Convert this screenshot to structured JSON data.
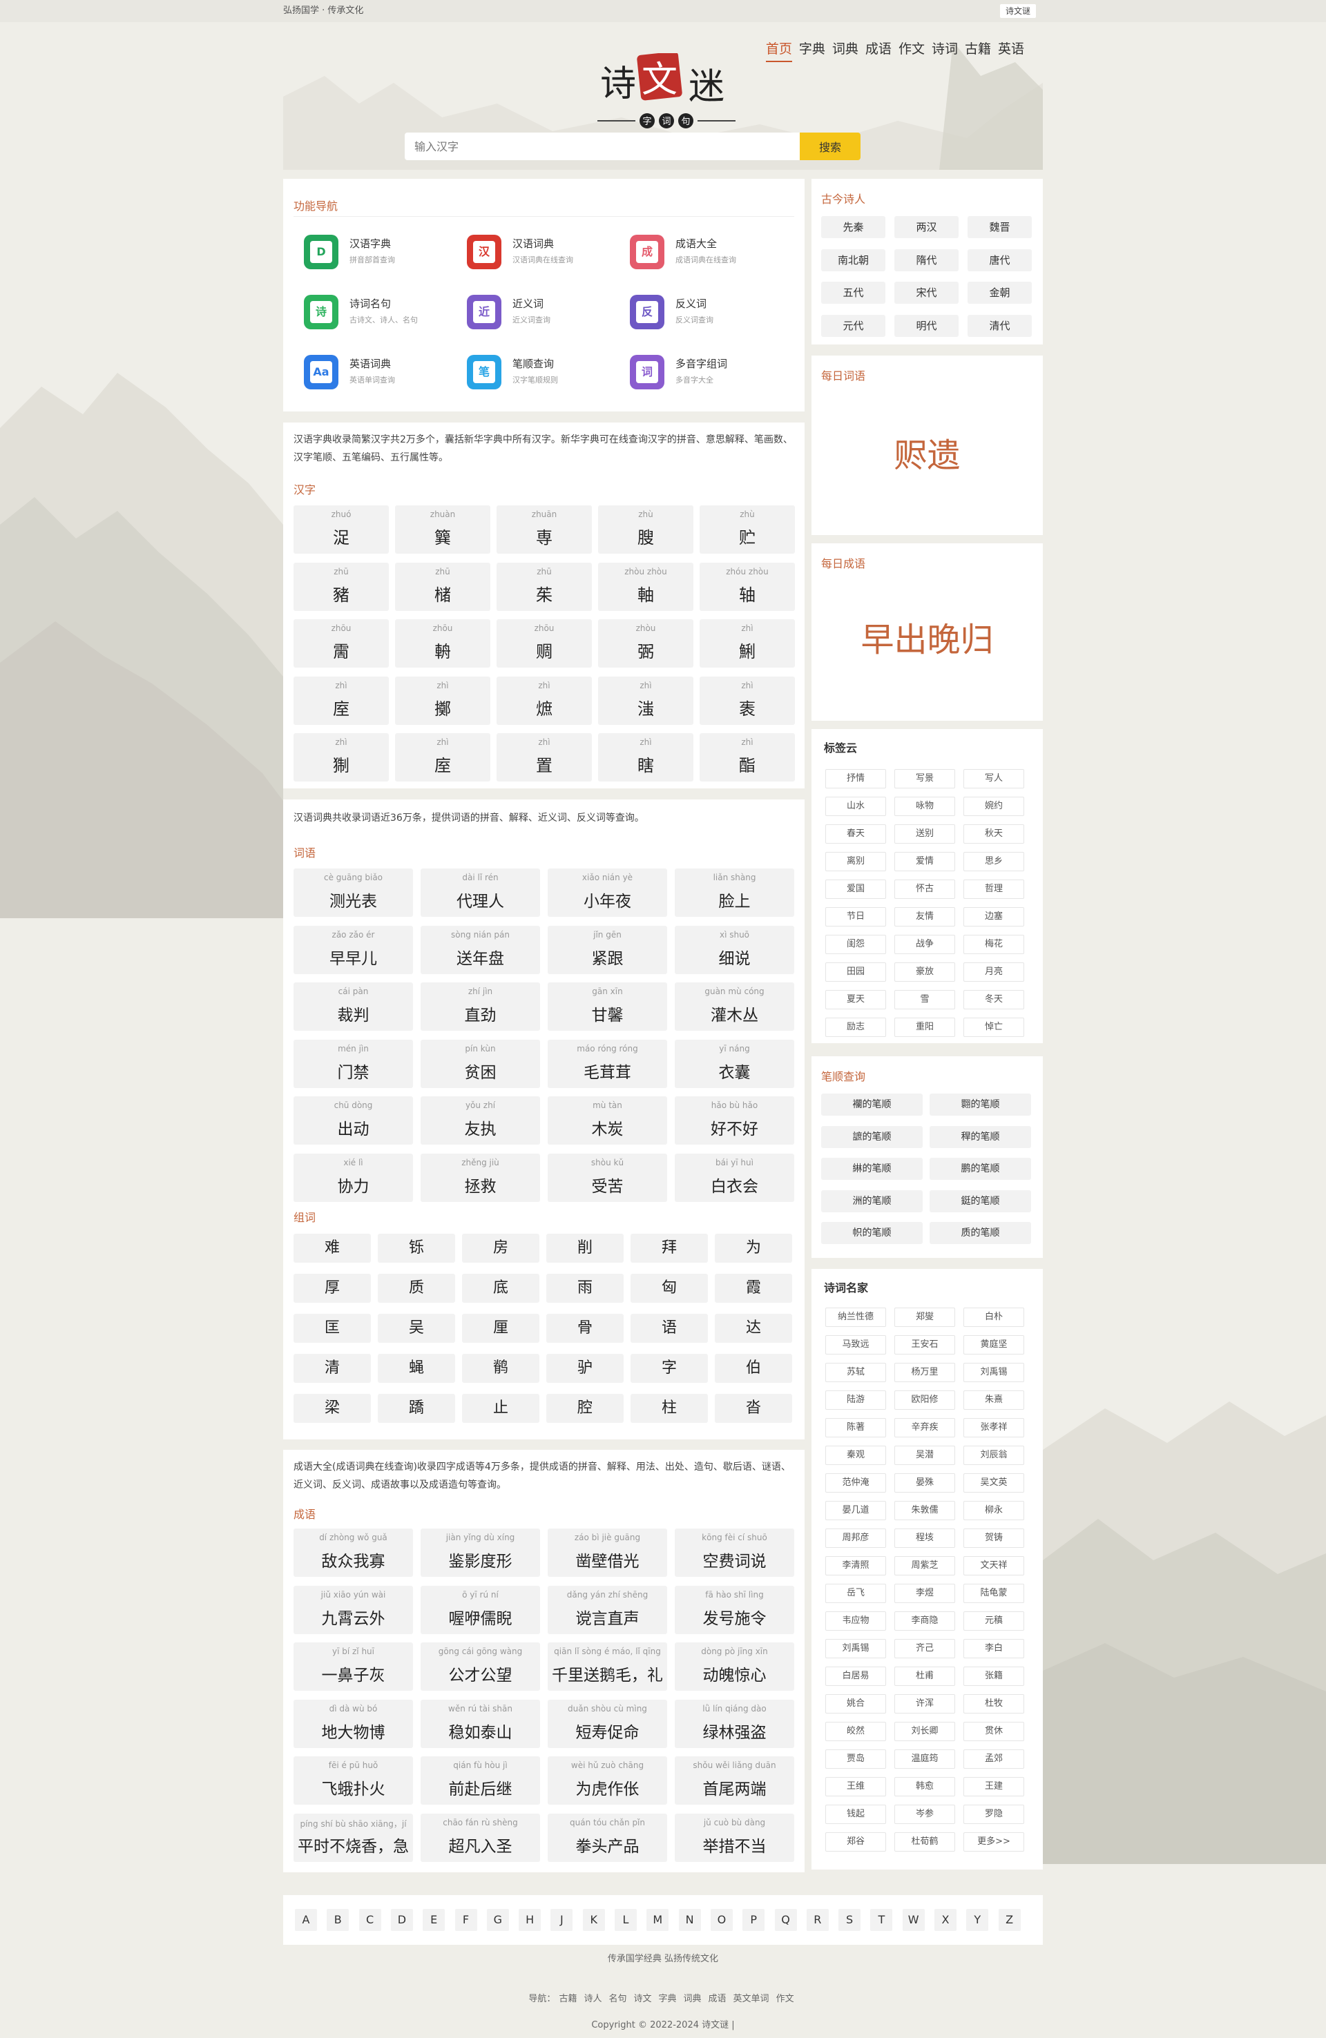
{
  "topbar": {
    "slogan": "弘扬国学 · 传承文化",
    "button": "诗文谜"
  },
  "logo": {
    "main": [
      "诗",
      "文",
      "迷"
    ],
    "sub": [
      "字",
      "词",
      "句"
    ]
  },
  "nav": [
    "首页",
    "字典",
    "词典",
    "成语",
    "作文",
    "诗词",
    "古籍",
    "英语"
  ],
  "search": {
    "placeholder": "输入汉字",
    "button": "搜索"
  },
  "features": {
    "title": "功能导航",
    "items": [
      {
        "name": "汉语字典",
        "desc": "拼音部首查询",
        "icon": "D",
        "color": "#23a55b"
      },
      {
        "name": "汉语词典",
        "desc": "汉语词典在线查询",
        "icon": "汉",
        "color": "#d9382e"
      },
      {
        "name": "成语大全",
        "desc": "成语词典在线查询",
        "icon": "成",
        "color": "#e45b6c"
      },
      {
        "name": "诗词名句",
        "desc": "古诗文、诗人、名句",
        "icon": "诗",
        "color": "#2bb25d"
      },
      {
        "name": "近义词",
        "desc": "近义词查询",
        "icon": "近",
        "color": "#7b5bc9"
      },
      {
        "name": "反义词",
        "desc": "反义词查询",
        "icon": "反",
        "color": "#6d57c4"
      },
      {
        "name": "英语词典",
        "desc": "英语单词查询",
        "icon": "Aa",
        "color": "#2d7be6"
      },
      {
        "name": "笔顺查询",
        "desc": "汉字笔顺规则",
        "icon": "笔",
        "color": "#28a4e6"
      },
      {
        "name": "多音字组词",
        "desc": "多音字大全",
        "icon": "词",
        "color": "#8a5ccf"
      }
    ]
  },
  "dict": {
    "intro": "汉语字典收录简繁汉字共2万多个，囊括新华字典中所有汉字。新华字典可在线查询汉字的拼音、意思解释、笔画数、汉字笔顺、五笔编码、五行属性等。",
    "title": "汉字",
    "cells": [
      {
        "py": "zhuó",
        "hz": "浞"
      },
      {
        "py": "zhuàn",
        "hz": "簨"
      },
      {
        "py": "zhuān",
        "hz": "専"
      },
      {
        "py": "zhù",
        "hz": "膄"
      },
      {
        "py": "zhù",
        "hz": "贮"
      },
      {
        "py": "zhū",
        "hz": "豬"
      },
      {
        "py": "zhū",
        "hz": "槠"
      },
      {
        "py": "zhū",
        "hz": "茱"
      },
      {
        "py": "zhòu zhòu",
        "hz": "軸"
      },
      {
        "py": "zhóu zhòu",
        "hz": "轴"
      },
      {
        "py": "zhōu",
        "hz": "霌"
      },
      {
        "py": "zhōu",
        "hz": "輈"
      },
      {
        "py": "zhōu",
        "hz": "赒"
      },
      {
        "py": "zhòu",
        "hz": "弻"
      },
      {
        "py": "zhì",
        "hz": "鯏"
      },
      {
        "py": "zhì",
        "hz": "庢"
      },
      {
        "py": "zhì",
        "hz": "擲"
      },
      {
        "py": "zhì",
        "hz": "熫"
      },
      {
        "py": "zhì",
        "hz": "滍"
      },
      {
        "py": "zhì",
        "hz": "袠"
      },
      {
        "py": "zhì",
        "hz": "猘"
      },
      {
        "py": "zhì",
        "hz": "庢"
      },
      {
        "py": "zhì",
        "hz": "置"
      },
      {
        "py": "zhì",
        "hz": "瞎"
      },
      {
        "py": "zhì",
        "hz": "酯"
      }
    ]
  },
  "words": {
    "intro": "汉语词典共收录词语近36万条，提供词语的拼音、解释、近义词、反义词等查询。",
    "title": "词语",
    "cells": [
      {
        "py": "cè guāng biǎo",
        "hz": "测光表"
      },
      {
        "py": "dài lǐ rén",
        "hz": "代理人"
      },
      {
        "py": "xiǎo nián yè",
        "hz": "小年夜"
      },
      {
        "py": "liǎn shàng",
        "hz": "脸上"
      },
      {
        "py": "zǎo zǎo ér",
        "hz": "早早儿"
      },
      {
        "py": "sòng nián pán",
        "hz": "送年盘"
      },
      {
        "py": "jǐn gēn",
        "hz": "紧跟"
      },
      {
        "py": "xì shuō",
        "hz": "细说"
      },
      {
        "py": "cái pàn",
        "hz": "裁判"
      },
      {
        "py": "zhí jìn",
        "hz": "直劲"
      },
      {
        "py": "gān xīn",
        "hz": "甘馨"
      },
      {
        "py": "guàn mù cóng",
        "hz": "灌木丛"
      },
      {
        "py": "mén jìn",
        "hz": "门禁"
      },
      {
        "py": "pín kùn",
        "hz": "贫困"
      },
      {
        "py": "máo róng róng",
        "hz": "毛茸茸"
      },
      {
        "py": "yī náng",
        "hz": "衣囊"
      },
      {
        "py": "chū dòng",
        "hz": "出动"
      },
      {
        "py": "yǒu zhí",
        "hz": "友执"
      },
      {
        "py": "mù tàn",
        "hz": "木炭"
      },
      {
        "py": "hǎo bù hǎo",
        "hz": "好不好"
      },
      {
        "py": "xié lì",
        "hz": "协力"
      },
      {
        "py": "zhěng jiù",
        "hz": "拯救"
      },
      {
        "py": "shòu kǔ",
        "hz": "受苦"
      },
      {
        "py": "bái yī huì",
        "hz": "白衣会"
      }
    ]
  },
  "zuci": {
    "title": "组词",
    "chars": [
      "难",
      "铄",
      "房",
      "削",
      "拜",
      "为",
      "厚",
      "质",
      "底",
      "雨",
      "匈",
      "霞",
      "匡",
      "吴",
      "厘",
      "骨",
      "语",
      "达",
      "清",
      "蝇",
      "鹡",
      "驴",
      "字",
      "伯",
      "梁",
      "蹻",
      "止",
      "腔",
      "柱",
      "沓"
    ]
  },
  "idioms": {
    "intro": "成语大全(成语词典在线查询)收录四字成语等4万多条，提供成语的拼音、解释、用法、出处、造句、歇后语、谜语、近义词、反义词、成语故事以及成语造句等查询。",
    "title": "成语",
    "cells": [
      {
        "py": "dí zhòng wǒ guǎ",
        "hz": "敌众我寡"
      },
      {
        "py": "jiàn yǐng dù xíng",
        "hz": "鉴影度形"
      },
      {
        "py": "záo bì jiè guāng",
        "hz": "凿壁借光"
      },
      {
        "py": "kōng fèi cí shuō",
        "hz": "空费词说"
      },
      {
        "py": "jiǔ xiāo yún wài",
        "hz": "九霄云外"
      },
      {
        "py": "ō yī rú ní",
        "hz": "喔咿儒睨"
      },
      {
        "py": "dǎng yán zhí shēng",
        "hz": "谠言直声"
      },
      {
        "py": "fā hào shī lìng",
        "hz": "发号施令"
      },
      {
        "py": "yī bí zǐ huī",
        "hz": "一鼻子灰"
      },
      {
        "py": "gōng cái gōng wàng",
        "hz": "公才公望"
      },
      {
        "py": "qiān lǐ sòng é máo, lǐ qīng",
        "hz": "千里送鹅毛，礼"
      },
      {
        "py": "dòng pò jīng xīn",
        "hz": "动魄惊心"
      },
      {
        "py": "dì dà wù bó",
        "hz": "地大物博"
      },
      {
        "py": "wěn rú tài shān",
        "hz": "稳如泰山"
      },
      {
        "py": "duǎn shòu cù mìng",
        "hz": "短寿促命"
      },
      {
        "py": "lǜ lín qiáng dào",
        "hz": "绿林强盗"
      },
      {
        "py": "fēi é pū huǒ",
        "hz": "飞蛾扑火"
      },
      {
        "py": "qián fù hòu jì",
        "hz": "前赴后继"
      },
      {
        "py": "wèi hǔ zuò chāng",
        "hz": "为虎作伥"
      },
      {
        "py": "shǒu wěi liǎng duān",
        "hz": "首尾两端"
      },
      {
        "py": "píng shí bù shāo xiāng，jí",
        "hz": "平时不烧香，急"
      },
      {
        "py": "chāo fán rù shèng",
        "hz": "超凡入圣"
      },
      {
        "py": "quán tóu chǎn pǐn",
        "hz": "拳头产品"
      },
      {
        "py": "jǔ cuò bù dàng",
        "hz": "举措不当"
      }
    ]
  },
  "letters": [
    "A",
    "B",
    "C",
    "D",
    "E",
    "F",
    "G",
    "H",
    "J",
    "K",
    "L",
    "M",
    "N",
    "O",
    "P",
    "Q",
    "R",
    "S",
    "T",
    "W",
    "X",
    "Y",
    "Z"
  ],
  "poets": {
    "title": "古今诗人",
    "items": [
      "先秦",
      "两汉",
      "魏晋",
      "南北朝",
      "隋代",
      "唐代",
      "五代",
      "宋代",
      "金朝",
      "元代",
      "明代",
      "清代"
    ]
  },
  "daily_word": {
    "title": "每日词语",
    "word": "赆遗"
  },
  "daily_idiom": {
    "title": "每日成语",
    "word": "早出晚归"
  },
  "tags": {
    "title": "标签云",
    "items": [
      "抒情",
      "写景",
      "写人",
      "山水",
      "咏物",
      "婉约",
      "春天",
      "送别",
      "秋天",
      "离别",
      "爱情",
      "思乡",
      "爱国",
      "怀古",
      "哲理",
      "节日",
      "友情",
      "边塞",
      "闺怨",
      "战争",
      "梅花",
      "田园",
      "豪放",
      "月亮",
      "夏天",
      "雪",
      "冬天",
      "励志",
      "重阳",
      "悼亡"
    ]
  },
  "stroke": {
    "title": "笔顺查询",
    "items": [
      "襴的笔顺",
      "翾的笔顺",
      "謶的笔顺",
      "稈的笔顺",
      "綝的笔顺",
      "鹏的笔顺",
      "洲的笔顺",
      "鋌的笔顺",
      "帜的笔顺",
      "质的笔顺"
    ]
  },
  "masters": {
    "title": "诗词名家",
    "items": [
      "纳兰性德",
      "郑燮",
      "白朴",
      "马致远",
      "王安石",
      "黄庭坚",
      "苏轼",
      "杨万里",
      "刘禹锡",
      "陆游",
      "欧阳修",
      "朱熹",
      "陈著",
      "辛弃疾",
      "张孝祥",
      "秦观",
      "吴潜",
      "刘辰翁",
      "范仲淹",
      "晏殊",
      "吴文英",
      "晏几道",
      "朱敦儒",
      "柳永",
      "周邦彦",
      "程垓",
      "贺铸",
      "李清照",
      "周紫芝",
      "文天祥",
      "岳飞",
      "李煜",
      "陆龟蒙",
      "韦应物",
      "李商隐",
      "元稹",
      "刘禹锡",
      "齐己",
      "李白",
      "白居易",
      "杜甫",
      "张籍",
      "姚合",
      "许浑",
      "杜牧",
      "皎然",
      "刘长卿",
      "贯休",
      "贾岛",
      "温庭筠",
      "孟郊",
      "王维",
      "韩愈",
      "王建",
      "钱起",
      "岑参",
      "罗隐",
      "郑谷",
      "杜荀鹤",
      "更多>>"
    ]
  },
  "footer": {
    "line1": "传承国学经典 弘扬传统文化",
    "nav_label": "导航：",
    "nav": [
      "古籍",
      "诗人",
      "名句",
      "诗文",
      "字典",
      "词典",
      "成语",
      "英文单词",
      "作文"
    ],
    "copyright": "Copyright © 2022-2024 诗文谜  |"
  }
}
